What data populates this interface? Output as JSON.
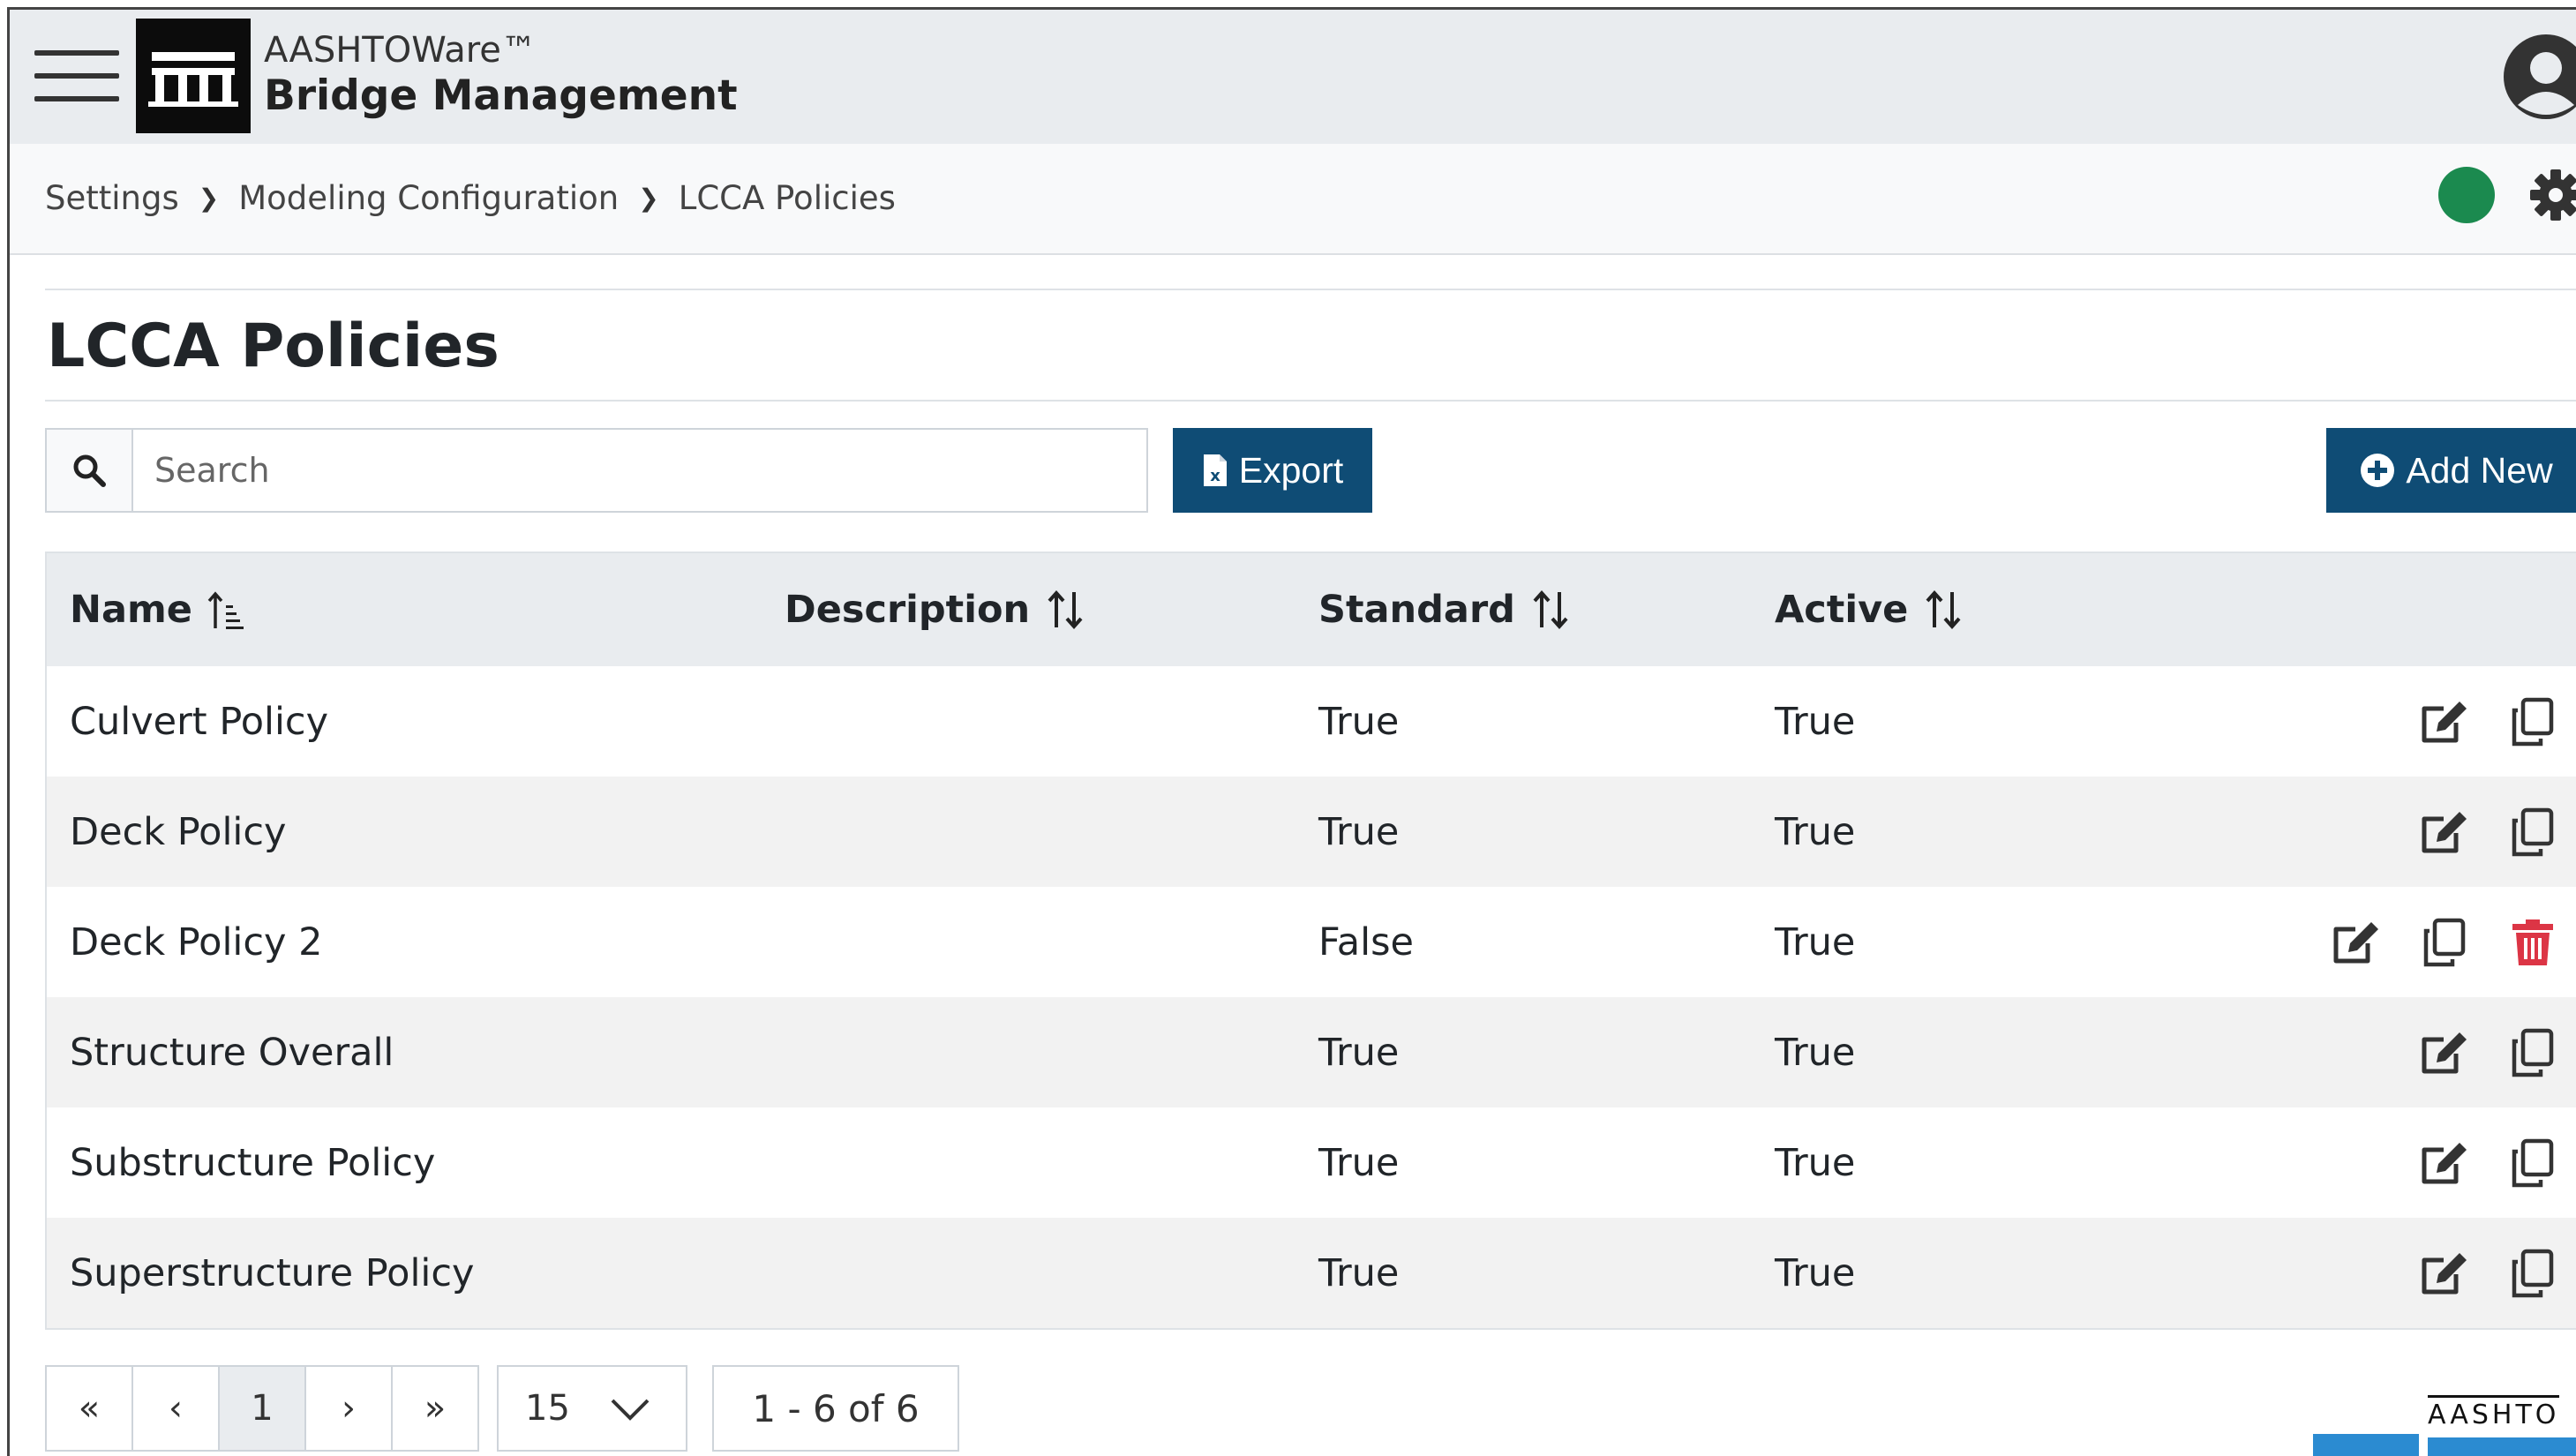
{
  "header": {
    "brand_line1": "AASHTOWare™",
    "brand_line2": "Bridge Management"
  },
  "breadcrumb": [
    "Settings",
    "Modeling Configuration",
    "LCCA Policies"
  ],
  "breadcrumb_separator": "❯",
  "status_color": "#1b8a4f",
  "page": {
    "title": "LCCA Policies"
  },
  "toolbar": {
    "search_placeholder": "Search",
    "export_label": "Export",
    "add_new_label": "Add New"
  },
  "table": {
    "columns": {
      "name": "Name",
      "description": "Description",
      "standard": "Standard",
      "active": "Active"
    },
    "rows": [
      {
        "name": "Culvert Policy",
        "description": "",
        "standard": "True",
        "active": "True",
        "deletable": false
      },
      {
        "name": "Deck Policy",
        "description": "",
        "standard": "True",
        "active": "True",
        "deletable": false
      },
      {
        "name": "Deck Policy 2",
        "description": "",
        "standard": "False",
        "active": "True",
        "deletable": true
      },
      {
        "name": "Structure Overall",
        "description": "",
        "standard": "True",
        "active": "True",
        "deletable": false
      },
      {
        "name": "Substructure Policy",
        "description": "",
        "standard": "True",
        "active": "True",
        "deletable": false
      },
      {
        "name": "Superstructure Policy",
        "description": "",
        "standard": "True",
        "active": "True",
        "deletable": false
      }
    ]
  },
  "pager": {
    "first": "«",
    "prev": "‹",
    "current_page": "1",
    "next": "›",
    "last": "»",
    "page_size": "15",
    "info": "1 - 6 of 6"
  },
  "footer": {
    "logo_text": "AASHTO"
  },
  "colors": {
    "primary": "#0f4c75",
    "delete": "#dc3545"
  }
}
